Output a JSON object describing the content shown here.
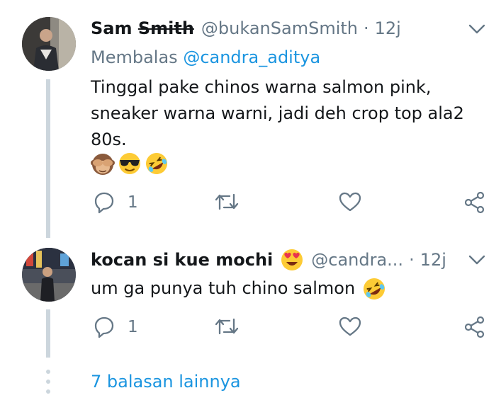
{
  "tweets": [
    {
      "name_first": "Sam ",
      "name_struck": "Smith",
      "handle": "@bukanSamSmith",
      "separator": "·",
      "time": "12j",
      "replying_prefix": "Membalas ",
      "replying_to": "@candra_aditya",
      "text": "Tinggal pake chinos warna salmon pink,\nsneaker warna warni, jadi deh crop top ala2\n80s.",
      "emojis": [
        "see-no-evil-monkey-emoji",
        "sunglasses-face-emoji",
        "rolling-laughing-emoji"
      ],
      "reply_count": "1"
    },
    {
      "name": "kocan si kue mochi",
      "name_emoji": "heart-eyes-emoji",
      "handle": "@candra...",
      "separator": "·",
      "time": "12j",
      "text": "um ga punya tuh chino salmon",
      "text_emoji": "rolling-laughing-emoji",
      "reply_count": "1"
    }
  ],
  "more_replies": "7 balasan lainnya",
  "colors": {
    "text": "#14171a",
    "secondary": "#657786",
    "link": "#1b95e0",
    "thread_line": "#ccd6dd"
  }
}
